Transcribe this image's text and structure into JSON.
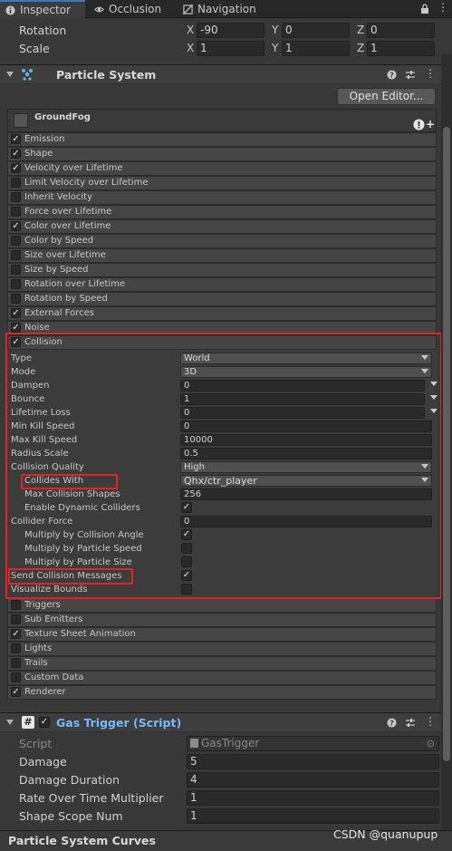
{
  "tabs": [
    {
      "label": "Inspector",
      "icon": "info-icon"
    },
    {
      "label": "Occlusion",
      "icon": "eye-icon"
    },
    {
      "label": "Navigation",
      "icon": "navigation-icon"
    }
  ],
  "transform": {
    "rotation": {
      "label": "Rotation",
      "x": "-90",
      "y": "0",
      "z": "0"
    },
    "scale": {
      "label": "Scale",
      "x": "1",
      "y": "1",
      "z": "1"
    },
    "axis": {
      "x": "X",
      "y": "Y",
      "z": "Z"
    }
  },
  "particle_system": {
    "title": "Particle System",
    "open_editor": "Open Editor...",
    "system_name": "GroundFog",
    "modules_top": [
      {
        "label": "Emission",
        "checked": true
      },
      {
        "label": "Shape",
        "checked": true
      },
      {
        "label": "Velocity over Lifetime",
        "checked": true
      },
      {
        "label": "Limit Velocity over Lifetime",
        "checked": false
      },
      {
        "label": "Inherit Velocity",
        "checked": false
      },
      {
        "label": "Force over Lifetime",
        "checked": false
      },
      {
        "label": "Color over Lifetime",
        "checked": true
      },
      {
        "label": "Color by Speed",
        "checked": false
      },
      {
        "label": "Size over Lifetime",
        "checked": false
      },
      {
        "label": "Size by Speed",
        "checked": false
      },
      {
        "label": "Rotation over Lifetime",
        "checked": false
      },
      {
        "label": "Rotation by Speed",
        "checked": false
      },
      {
        "label": "External Forces",
        "checked": true
      },
      {
        "label": "Noise",
        "checked": true
      },
      {
        "label": "Collision",
        "checked": true
      }
    ],
    "collision": {
      "type": {
        "label": "Type",
        "value": "World"
      },
      "mode": {
        "label": "Mode",
        "value": "3D"
      },
      "dampen": {
        "label": "Dampen",
        "value": "0"
      },
      "bounce": {
        "label": "Bounce",
        "value": "1"
      },
      "lifetime_loss": {
        "label": "Lifetime Loss",
        "value": "0"
      },
      "min_kill_speed": {
        "label": "Min Kill Speed",
        "value": "0"
      },
      "max_kill_speed": {
        "label": "Max Kill Speed",
        "value": "10000"
      },
      "radius_scale": {
        "label": "Radius Scale",
        "value": "0.5"
      },
      "collision_quality": {
        "label": "Collision Quality",
        "value": "High"
      },
      "collides_with": {
        "label": "Collides With",
        "value": "Qhx/ctr_player"
      },
      "max_collision_shapes": {
        "label": "Max Collision Shapes",
        "value": "256"
      },
      "enable_dynamic_colliders": {
        "label": "Enable Dynamic Colliders",
        "checked": true
      },
      "collider_force": {
        "label": "Collider Force",
        "value": "0"
      },
      "multiply_by_collision_angle": {
        "label": "Multiply by Collision Angle",
        "checked": true
      },
      "multiply_by_particle_speed": {
        "label": "Multiply by Particle Speed",
        "checked": false
      },
      "multiply_by_particle_size": {
        "label": "Multiply by Particle Size",
        "checked": false
      },
      "send_collision_messages": {
        "label": "Send Collision Messages",
        "checked": true
      },
      "visualize_bounds": {
        "label": "Visualize Bounds",
        "checked": false
      }
    },
    "modules_bottom": [
      {
        "label": "Triggers",
        "checked": false
      },
      {
        "label": "Sub Emitters",
        "checked": false
      },
      {
        "label": "Texture Sheet Animation",
        "checked": true
      },
      {
        "label": "Lights",
        "checked": false
      },
      {
        "label": "Trails",
        "checked": false
      },
      {
        "label": "Custom Data",
        "checked": false
      },
      {
        "label": "Renderer",
        "checked": true
      }
    ]
  },
  "gas_trigger": {
    "title": "Gas Trigger (Script)",
    "script": {
      "label": "Script",
      "value": "GasTrigger"
    },
    "damage": {
      "label": "Damage",
      "value": "5"
    },
    "damage_duration": {
      "label": "Damage Duration",
      "value": "4"
    },
    "rate_over_time_multiplier": {
      "label": "Rate Over Time Multiplier",
      "value": "1"
    },
    "shape_scope_num": {
      "label": "Shape Scope Num",
      "value": "1"
    }
  },
  "footer": {
    "title": "Particle System Curves",
    "watermark": "CSDN @quanupup"
  },
  "colors": {
    "highlight_red": "#e5222a",
    "accent_blue": "#3a79bb",
    "script_title": "#79b8ff"
  }
}
